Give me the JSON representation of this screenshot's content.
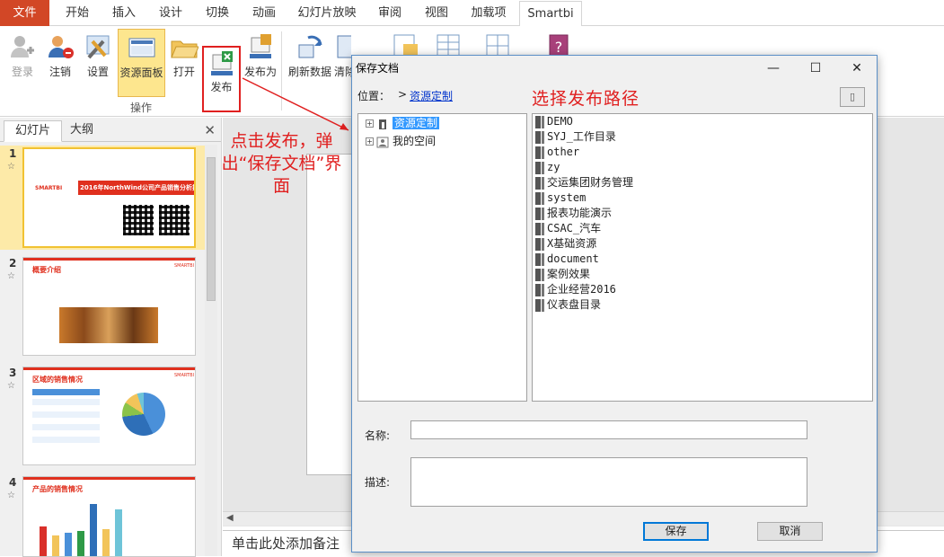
{
  "ribbon_tabs": [
    {
      "label": "文件"
    },
    {
      "label": "开始"
    },
    {
      "label": "插入"
    },
    {
      "label": "设计"
    },
    {
      "label": "切换"
    },
    {
      "label": "动画"
    },
    {
      "label": "幻灯片放映"
    },
    {
      "label": "审阅"
    },
    {
      "label": "视图"
    },
    {
      "label": "加载项"
    },
    {
      "label": "Smartbi"
    }
  ],
  "ribbon_buttons": {
    "login": "登录",
    "logout": "注销",
    "settings": "设置",
    "resource_panel": "资源面板",
    "open": "打开",
    "publish": "发布",
    "publish_as": "发布为",
    "refresh": "刷新数据",
    "clear": "清除"
  },
  "ribbon_group_label": "操作",
  "slides_pane": {
    "tab_slides": "幻灯片",
    "tab_outline": "大纲",
    "close_icon": "✕",
    "slides": [
      {
        "number": "1",
        "title": "2016年NorthWind公司产品销售分析报告",
        "logo": "SMARTBI"
      },
      {
        "number": "2",
        "title": "概要介绍",
        "logo": "SMARTBI"
      },
      {
        "number": "3",
        "title": "区域的销售情况",
        "logo": "SMARTBI"
      },
      {
        "number": "4",
        "title": "产品的销售情况"
      }
    ]
  },
  "annotations": {
    "publish_note": "点击发布，弹出“保存文档”界面",
    "path_note": "选择发布路径"
  },
  "notes_placeholder": "单击此处添加备注",
  "dialog": {
    "title": "保存文档",
    "location_label": "位置：",
    "location_arrow": ">",
    "location_link": "资源定制",
    "tree": [
      {
        "label": "资源定制",
        "selected": true
      },
      {
        "label": "我的空间",
        "selected": false
      }
    ],
    "folders": [
      "DEMO",
      "SYJ_工作目录",
      "other",
      "zy",
      "交运集团财务管理",
      "system",
      "报表功能演示",
      "CSAC_汽车",
      "X基础资源",
      "document",
      "案例效果",
      "企业经营2016",
      "仪表盘目录"
    ],
    "name_label": "名称:",
    "name_value": "",
    "desc_label": "描述:",
    "desc_value": "",
    "save_button": "保存",
    "cancel_button": "取消"
  },
  "colors": {
    "file_tab": "#d24726",
    "annotation_red": "#e02020",
    "selection_blue": "#3399ff",
    "pressed_button": "#fde68e"
  }
}
